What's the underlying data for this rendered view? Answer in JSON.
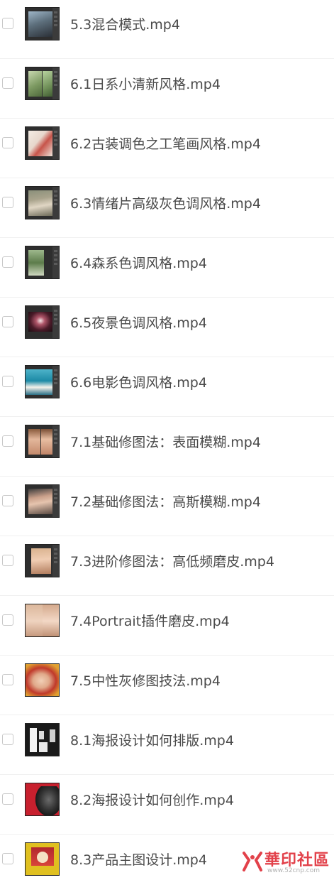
{
  "files": [
    {
      "name": "5.3混合模式.mp4",
      "thumb": "photoshop-blend-mode-thumbnail"
    },
    {
      "name": "6.1日系小清新风格.mp4",
      "thumb": "japanese-fresh-style-thumbnail"
    },
    {
      "name": "6.2古装调色之工笔画风格.mp4",
      "thumb": "ancient-costume-painting-thumbnail"
    },
    {
      "name": "6.3情绪片高级灰色调风格.mp4",
      "thumb": "mood-gray-tone-thumbnail"
    },
    {
      "name": "6.4森系色调风格.mp4",
      "thumb": "forest-tone-thumbnail"
    },
    {
      "name": "6.5夜景色调风格.mp4",
      "thumb": "night-scene-thumbnail"
    },
    {
      "name": "6.6电影色调风格.mp4",
      "thumb": "cinematic-tone-thumbnail"
    },
    {
      "name": "7.1基础修图法：表面模糊.mp4",
      "thumb": "surface-blur-portrait-thumbnail"
    },
    {
      "name": "7.2基础修图法：高斯模糊.mp4",
      "thumb": "gaussian-blur-portrait-thumbnail"
    },
    {
      "name": "7.3进阶修图法：高低频磨皮.mp4",
      "thumb": "frequency-separation-thumbnail"
    },
    {
      "name": "7.4Portrait插件磨皮.mp4",
      "thumb": "portrait-plugin-thumbnail"
    },
    {
      "name": "7.5中性灰修图技法.mp4",
      "thumb": "neutral-gray-retouch-thumbnail"
    },
    {
      "name": "8.1海报设计如何排版.mp4",
      "thumb": "poster-layout-thumbnail"
    },
    {
      "name": "8.2海报设计如何创作.mp4",
      "thumb": "poster-creation-thumbnail"
    },
    {
      "name": "8.3产品主图设计.mp4",
      "thumb": "product-main-image-thumbnail"
    }
  ],
  "watermark": {
    "logo_text": "華印社區",
    "url": "www.52cnp.com",
    "icon": "52cnp-logo-icon"
  }
}
